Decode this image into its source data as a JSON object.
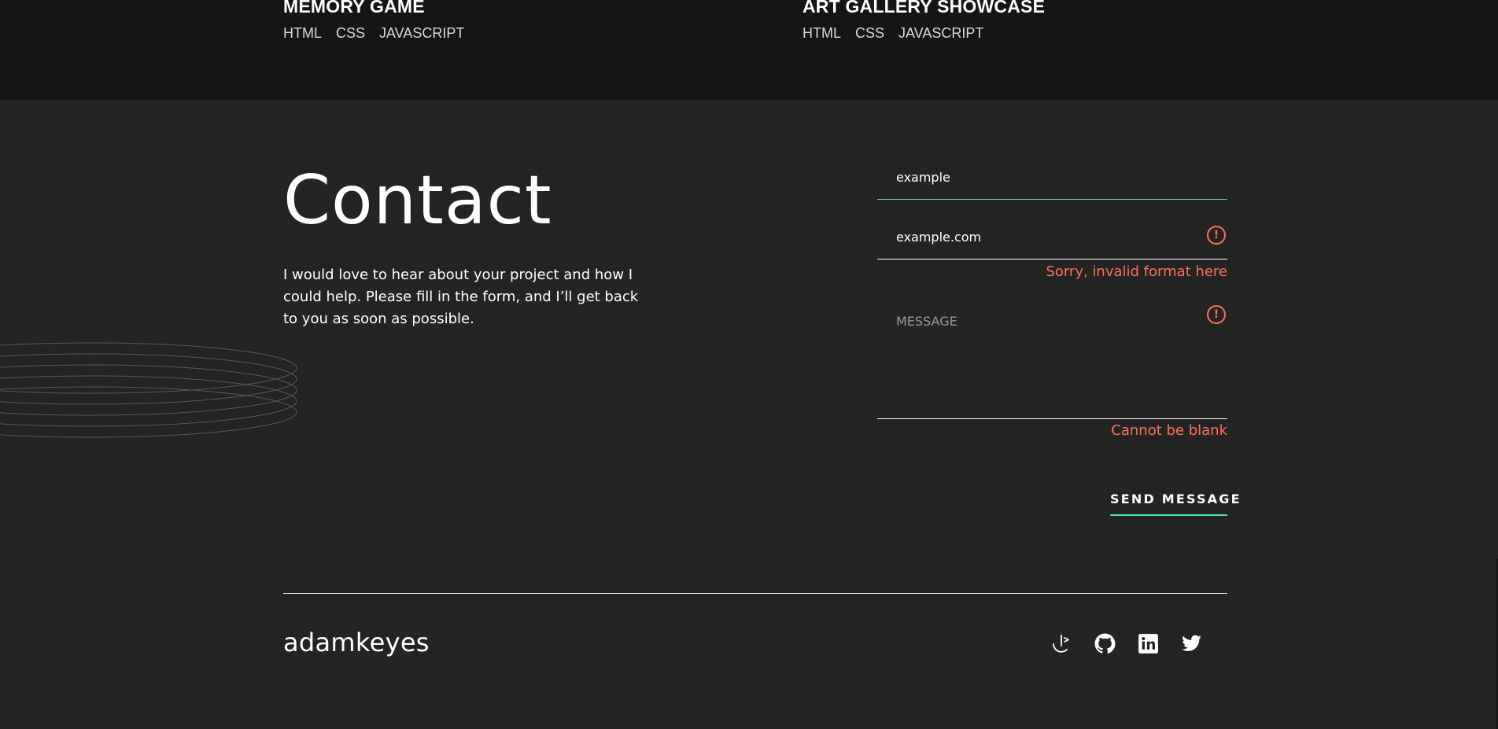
{
  "projects": [
    {
      "title": "MEMORY GAME",
      "tags": [
        "HTML",
        "CSS",
        "JAVASCRIPT"
      ]
    },
    {
      "title": "ART GALLERY SHOWCASE",
      "tags": [
        "HTML",
        "CSS",
        "JAVASCRIPT"
      ]
    }
  ],
  "contact": {
    "heading": "Contact",
    "description": "I would love to hear about your project and how I could help. Please fill in the form, and I’ll get back to you as soon as possible."
  },
  "form": {
    "name": {
      "value": "example",
      "state": "valid"
    },
    "email": {
      "value": "example.com",
      "state": "error",
      "error": "Sorry, invalid format here"
    },
    "message": {
      "value": "",
      "placeholder": "MESSAGE",
      "state": "error",
      "error": "Cannot be blank"
    },
    "error_icon": "!",
    "submit_label": "SEND MESSAGE"
  },
  "footer": {
    "logo": "adamkeyes",
    "socials": [
      "frontend-mentor-icon",
      "github-icon",
      "linkedin-icon",
      "twitter-icon"
    ]
  },
  "colors": {
    "accent": "#4ee1a0",
    "error": "#ff6f5b",
    "background": "#242424",
    "projects_background": "#151515"
  }
}
